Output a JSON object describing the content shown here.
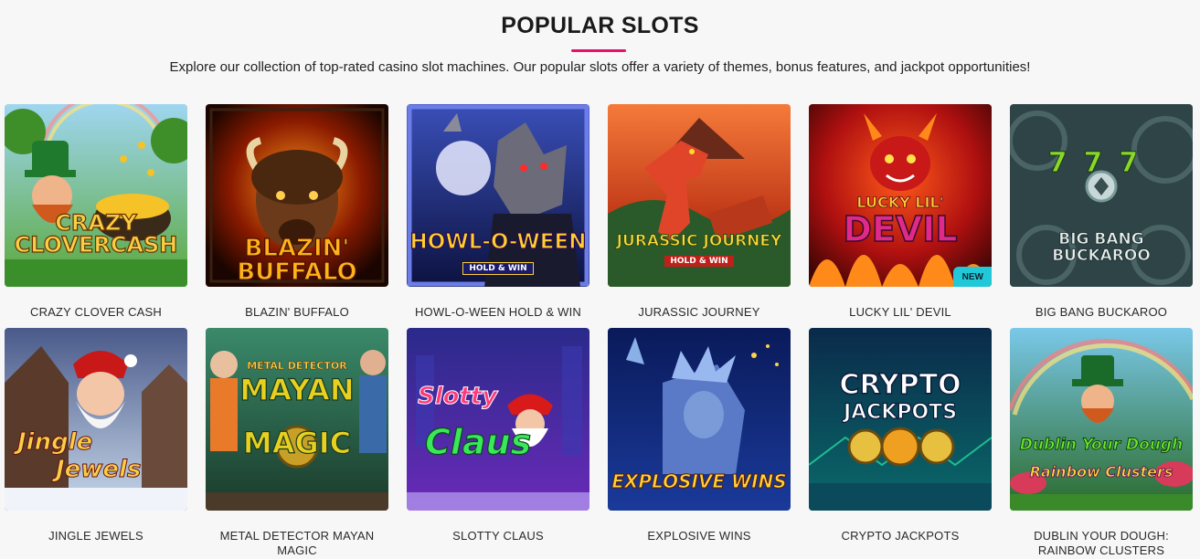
{
  "section": {
    "title": "POPULAR SLOTS",
    "subtitle": "Explore our collection of top-rated casino slot machines. Our popular slots offer a variety of themes, bonus features, and jackpot opportunities!"
  },
  "games": [
    {
      "name": "CRAZY CLOVER CASH",
      "logo": "CRAZY CLOVERCASH"
    },
    {
      "name": "BLAZIN' BUFFALO",
      "logo": "BLAZIN' BUFFALO"
    },
    {
      "name": "HOWL-O-WEEN HOLD & WIN",
      "logo": "HOWL-O-WEEN",
      "logo_sub": "HOLD & WIN"
    },
    {
      "name": "JURASSIC JOURNEY",
      "logo": "JURASSIC JOURNEY",
      "logo_sub": "HOLD & WIN"
    },
    {
      "name": "LUCKY LIL' DEVIL",
      "logo": "LUCKY LIL'",
      "logo2": "DEVIL",
      "badge": "NEW"
    },
    {
      "name": "BIG BANG BUCKAROO",
      "logo": "BIG BANG",
      "logo2": "BUCKAROO",
      "reels": "777"
    },
    {
      "name": "JINGLE JEWELS",
      "logo": "Jingle",
      "logo2": "Jewels"
    },
    {
      "name": "METAL DETECTOR MAYAN MAGIC",
      "logo_top": "METAL DETECTOR",
      "logo": "MAYAN",
      "logo2": "MAGIC"
    },
    {
      "name": "SLOTTY CLAUS",
      "logo": "Slotty",
      "logo2": "Claus"
    },
    {
      "name": "EXPLOSIVE WINS",
      "logo": "EXPLOSIVE WINS"
    },
    {
      "name": "CRYPTO JACKPOTS",
      "logo": "CRYPTO",
      "logo2": "JACKPOTS"
    },
    {
      "name": "DUBLIN YOUR DOUGH: RAINBOW CLUSTERS",
      "logo": "Dublin Your Dough",
      "logo2": "Rainbow Clusters"
    }
  ],
  "colors": {
    "accent": "#e8106b",
    "badge": "#20c8d8",
    "background": "#f7f7f7"
  }
}
